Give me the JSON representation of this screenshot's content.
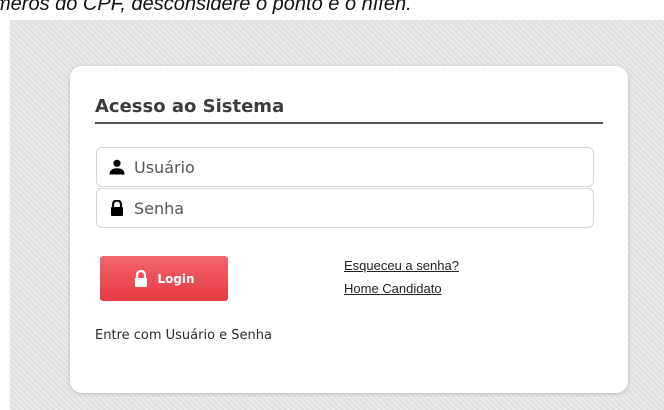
{
  "header_note": {
    "text": "meros do CPF, desconsidere o ponto e o hífen."
  },
  "login": {
    "title": "Acesso ao Sistema",
    "username_field": {
      "placeholder": "Usuário",
      "value": "",
      "icon": "user-icon"
    },
    "password_field": {
      "placeholder": "Senha",
      "value": "",
      "icon": "lock-icon"
    },
    "login_button": {
      "label": "Login",
      "icon": "lock-icon"
    },
    "links": {
      "forgot_password": "Esqueceu a senha?",
      "home_candidate": "Home Candidato"
    },
    "hint": "Entre com Usuário e Senha"
  },
  "colors": {
    "login_button": "#e9464d",
    "panel_background": "#ffffff",
    "page_background": "#e5e5e5",
    "title_rule": "#555555"
  }
}
